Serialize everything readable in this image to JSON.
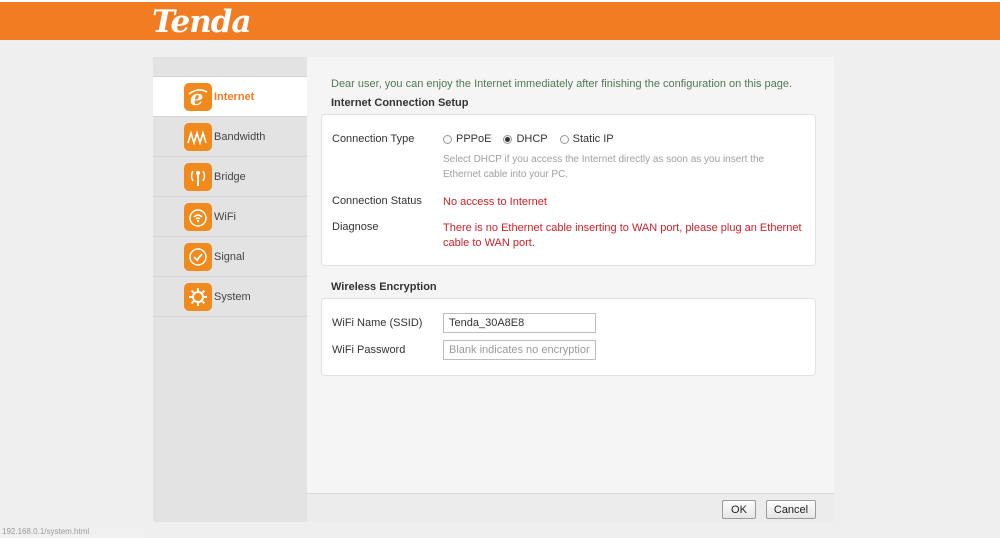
{
  "header": {
    "logo_text": "Tenda",
    "bar_color": "#f27c22"
  },
  "sidebar": {
    "items": [
      {
        "label": "Internet",
        "icon": "internet-e-icon",
        "active": true
      },
      {
        "label": "Bandwidth",
        "icon": "bandwidth-wave-icon",
        "active": false
      },
      {
        "label": "Bridge",
        "icon": "bridge-antenna-icon",
        "active": false
      },
      {
        "label": "WiFi",
        "icon": "wifi-icon",
        "active": false
      },
      {
        "label": "Signal",
        "icon": "signal-check-icon",
        "active": false
      },
      {
        "label": "System",
        "icon": "system-gear-icon",
        "active": false
      }
    ]
  },
  "main": {
    "intro": "Dear user, you can enjoy the Internet immediately after finishing the configuration on this page.",
    "internet_section": {
      "title": "Internet Connection Setup",
      "connection_type_label": "Connection Type",
      "options": [
        {
          "label": "PPPoE",
          "selected": false
        },
        {
          "label": "DHCP",
          "selected": true
        },
        {
          "label": "Static IP",
          "selected": false
        }
      ],
      "hint": "Select DHCP if you access the Internet directly as soon as you insert the Ethernet cable into your PC.",
      "status_label": "Connection Status",
      "status_value": "No access to Internet",
      "diagnose_label": "Diagnose",
      "diagnose_value": "There is no Ethernet cable inserting to WAN port, please plug an Ethernet cable to WAN port."
    },
    "wireless_section": {
      "title": "Wireless Encryption",
      "ssid_label": "WiFi Name (SSID)",
      "ssid_value": "Tenda_30A8E8",
      "password_label": "WiFi Password",
      "password_placeholder": "Blank indicates no encryption."
    },
    "buttons": {
      "ok": "OK",
      "cancel": "Cancel"
    }
  },
  "statusbar": {
    "url": "192.168.0.1/system.html"
  },
  "colors": {
    "accent": "#f27c22",
    "error": "#d0202a",
    "intro_text": "#4f7a54"
  }
}
